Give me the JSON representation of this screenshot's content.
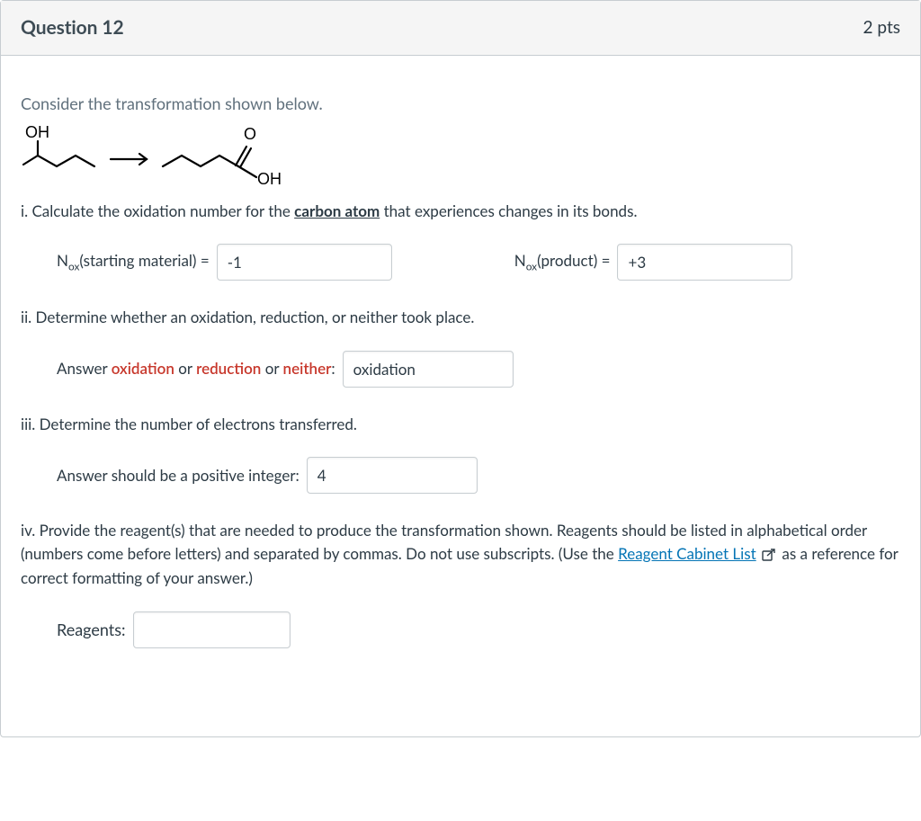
{
  "header": {
    "title": "Question 12",
    "points": "2 pts"
  },
  "intro": "Consider the transformation shown below.",
  "partI": {
    "prefix": "i. Calculate the oxidation number for the ",
    "emph": "carbon atom",
    "suffix": " that experiences changes in its bonds."
  },
  "nox": {
    "start_label_pre": "N",
    "start_label_sub": "ox",
    "start_label_post": "(starting material) =",
    "start_value": "-1",
    "prod_label_pre": "N",
    "prod_label_sub": "ox",
    "prod_label_post": "(product) =",
    "prod_value": "+3"
  },
  "partII": {
    "text": "ii. Determine whether an oxidation, reduction, or neither took place.",
    "ans_pre": "Answer ",
    "ox": "oxidation",
    "or1": " or ",
    "red": "reduction",
    "or2": " or ",
    "nei": "neither",
    "colon": ":",
    "value": "oxidation"
  },
  "partIII": {
    "text": "iii. Determine the number of electrons transferred.",
    "label": "Answer should be a positive integer:",
    "value": "4"
  },
  "partIV": {
    "text1": "iv. Provide the reagent(s) that are needed to produce the transformation shown. Reagents should be listed in alphabetical order (numbers come before letters) and separated by commas. Do not use subscripts. (Use the ",
    "link": "Reagent Cabinet List",
    "text2": " as a reference for correct formatting of your answer.)",
    "label": "Reagents:",
    "value": ""
  }
}
